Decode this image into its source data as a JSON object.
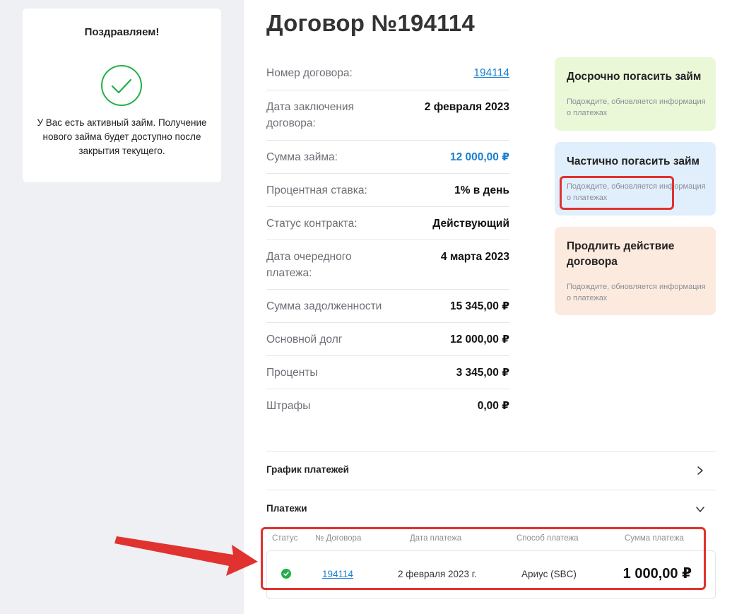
{
  "sidebar": {
    "congrats_title": "Поздравляем!",
    "congrats_text": "У Вас есть активный займ. Получение нового займа будет доступно после закрытия текущего."
  },
  "contract": {
    "title": "Договор №194114",
    "rows": [
      {
        "label": "Номер договора:",
        "value": "194114"
      },
      {
        "label": "Дата заключения договора:",
        "value": "2 февраля 2023"
      },
      {
        "label": "Сумма займа:",
        "value": "12 000,00 ₽"
      },
      {
        "label": "Процентная ставка:",
        "value": "1% в день"
      },
      {
        "label": "Статус контракта:",
        "value": "Действующий"
      },
      {
        "label": "Дата очередного платежа:",
        "value": "4 марта 2023"
      },
      {
        "label": "Сумма задолженности",
        "value": "15 345,00 ₽"
      },
      {
        "label": "Основной долг",
        "value": "12 000,00 ₽"
      },
      {
        "label": "Проценты",
        "value": "3 345,00 ₽"
      },
      {
        "label": "Штрафы",
        "value": "0,00 ₽"
      }
    ]
  },
  "actions": [
    {
      "title": "Досрочно погасить займ",
      "subtitle": "Подождите, обновляется информация о платежах",
      "color": "#eaf8d8"
    },
    {
      "title": "Частично погасить займ",
      "subtitle": "Подождите, обновляется информация о платежах",
      "color": "#e1eefb"
    },
    {
      "title": "Продлить действие договора",
      "subtitle": "Подождите, обновляется информация о платежах",
      "color": "#fdeadf"
    }
  ],
  "sections": {
    "schedule_title": "График платежей",
    "payments_title": "Платежи"
  },
  "payments": {
    "headers": [
      "Статус",
      "№ Договора",
      "Дата платежа",
      "Способ платежа",
      "Сумма платежа"
    ],
    "rows": [
      {
        "status": "success",
        "contract": "194114",
        "date": "2 февраля 2023 г.",
        "method": "Ариус (SBC)",
        "amount": "1 000,00 ₽"
      }
    ]
  },
  "colors": {
    "accent_blue": "#1a7fd1",
    "success_green": "#20b045",
    "highlight_red": "#e0322f"
  }
}
